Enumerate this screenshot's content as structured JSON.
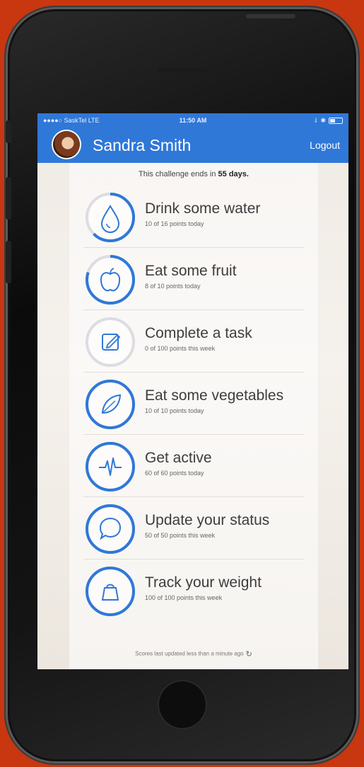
{
  "status_bar": {
    "carrier": "●●●●○ SaskTel  LTE",
    "time": "11:50 AM",
    "right": "⇃ ✱"
  },
  "header": {
    "user_name": "Sandra Smith",
    "logout_label": "Logout"
  },
  "challenge": {
    "prefix": "This challenge ends in ",
    "days": "55 days."
  },
  "activities": [
    {
      "title": "Drink some water",
      "subtitle": "10 of 16 points today",
      "progress": 0.625,
      "icon": "water-drop-icon"
    },
    {
      "title": "Eat some fruit",
      "subtitle": "8 of 10 points today",
      "progress": 0.8,
      "icon": "apple-icon"
    },
    {
      "title": "Complete a task",
      "subtitle": "0 of 100 points this week",
      "progress": 0,
      "icon": "edit-task-icon"
    },
    {
      "title": "Eat some vegetables",
      "subtitle": "10 of 10 points today",
      "progress": 1,
      "icon": "leaf-icon"
    },
    {
      "title": "Get active",
      "subtitle": "60 of 60 points today",
      "progress": 1,
      "icon": "activity-pulse-icon"
    },
    {
      "title": "Update your status",
      "subtitle": "50 of 50 points this week",
      "progress": 1,
      "icon": "speech-bubble-icon"
    },
    {
      "title": "Track your weight",
      "subtitle": "100 of 100 points this week",
      "progress": 1,
      "icon": "weight-icon"
    }
  ],
  "footer": {
    "text": "Scores last updated less than a minute ago",
    "icon": "refresh-icon"
  },
  "colors": {
    "accent": "#2f78d8",
    "track": "#dcdde2"
  }
}
